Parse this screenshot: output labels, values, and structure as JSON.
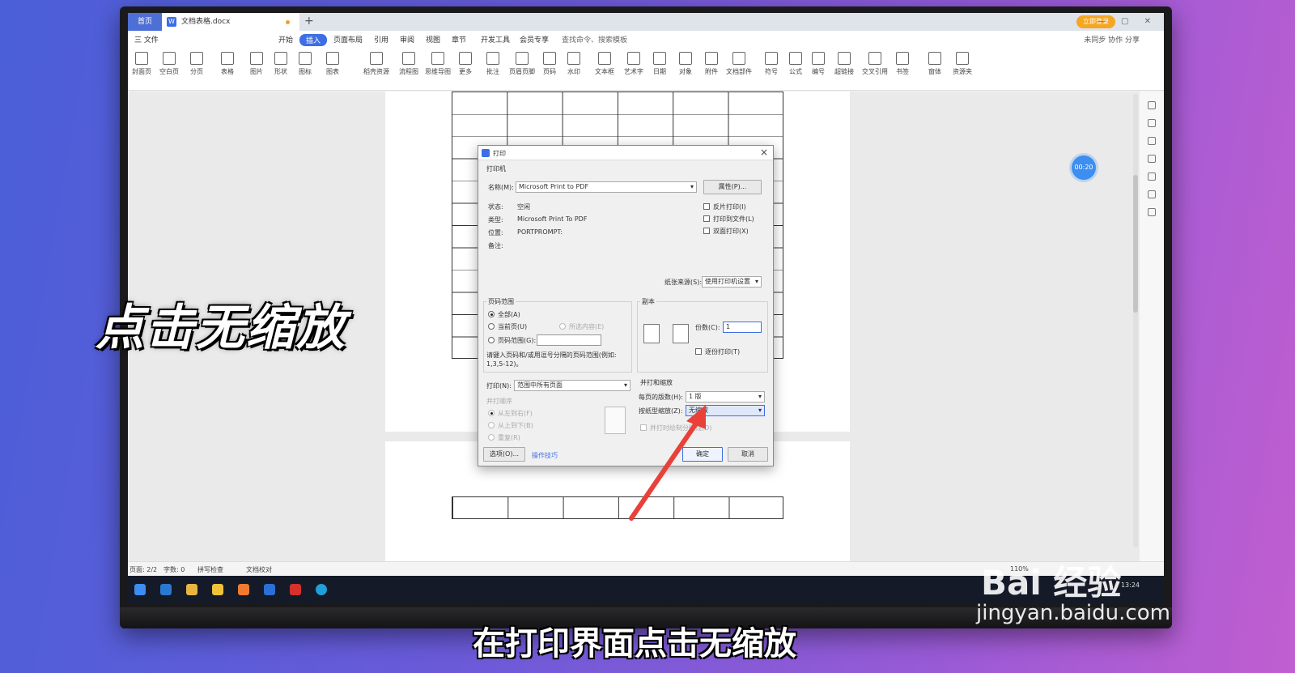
{
  "wps": {
    "tabs": {
      "home": "首页",
      "doc": "文档表格.docx",
      "login": "立即登录"
    },
    "menu": {
      "file": "三 文件",
      "items": [
        "开始",
        "插入",
        "页面布局",
        "引用",
        "审阅",
        "视图",
        "章节",
        "开发工具",
        "会员专享"
      ],
      "active": "插入",
      "search": "查找命令、搜索模板",
      "right": "未同步  协作  分享"
    },
    "ribbon": [
      "封面页",
      "空白页",
      "分页",
      "表格",
      "图片",
      "形状",
      "图标",
      "图表",
      "稻壳资源",
      "流程图",
      "思维导图",
      "更多",
      "批注",
      "页眉页脚",
      "页码",
      "水印",
      "文本框",
      "艺术字",
      "日期",
      "对象",
      "附件",
      "文档部件",
      "符号",
      "公式",
      "编号",
      "超链接",
      "交叉引用",
      "书签",
      "窗体",
      "资源夹"
    ],
    "timer": "00:20",
    "statusbar": {
      "page": "页面: 2/2",
      "words": "字数: 0",
      "spell": "拼写检查",
      "proof": "文档校对",
      "zoom": "110%"
    },
    "taskbar_time": "13:24"
  },
  "dialog": {
    "title": "打印",
    "printer_section": "打印机",
    "name_label": "名称(M):",
    "printer_name": "Microsoft Print to PDF",
    "properties": "属性(P)...",
    "status_label": "状态:",
    "status_value": "空闲",
    "type_label": "类型:",
    "type_value": "Microsoft Print To PDF",
    "location_label": "位置:",
    "location_value": "PORTPROMPT:",
    "comment_label": "备注:",
    "reverse_print": "反片打印(I)",
    "print_to_file": "打印到文件(L)",
    "duplex": "双面打印(X)",
    "paper_source_label": "纸张来源(S):",
    "paper_source_value": "使用打印机设置",
    "range_section": "页码范围",
    "range_all": "全部(A)",
    "range_current": "当前页(U)",
    "range_selection": "所选内容(E)",
    "range_pages": "页码范围(G):",
    "range_hint": "请键入页码和/或用逗号分隔的页码范围(例如: 1,3,5-12)。",
    "copies_section": "副本",
    "copies_label": "份数(C):",
    "copies_value": "1",
    "collate": "逐份打印(T)",
    "print_label": "打印(N):",
    "print_value": "范围中所有页面",
    "order_section": "并打顺序",
    "order_lr": "从左到右(F)",
    "order_tb": "从上到下(B)",
    "order_repeat": "重复(R)",
    "zoom_section": "并打和缩放",
    "pages_per_sheet_label": "每页的版数(H):",
    "pages_per_sheet_value": "1 版",
    "scale_label": "按纸型缩放(Z):",
    "scale_value": "无缩放",
    "draw_lines": "并打时绘制分隔线(D)",
    "options": "选项(O)...",
    "tips": "操作技巧",
    "ok": "确定",
    "cancel": "取消"
  },
  "overlay": {
    "caption": "点击无缩放",
    "subtitle": "在打印界面点击无缩放",
    "watermark": "Bai 经验",
    "watermark_url": "jingyan.baidu.com"
  },
  "colors": {
    "accent": "#3d6ee6",
    "arrow": "#e8413a",
    "background_left": "#4a5fd8",
    "background_right": "#c05ed0"
  }
}
